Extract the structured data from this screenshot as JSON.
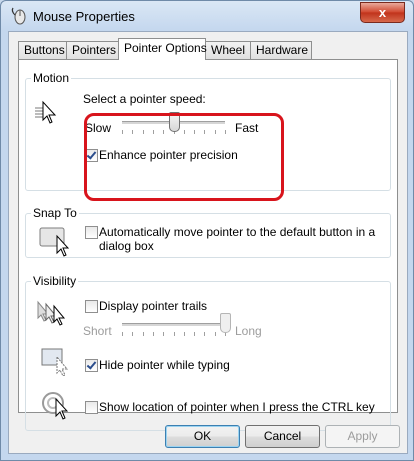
{
  "window": {
    "title": "Mouse Properties",
    "close_glyph": "x"
  },
  "tabs": [
    {
      "label": "Buttons",
      "active": false
    },
    {
      "label": "Pointers",
      "active": false
    },
    {
      "label": "Pointer Options",
      "active": true
    },
    {
      "label": "Wheel",
      "active": false
    },
    {
      "label": "Hardware",
      "active": false
    }
  ],
  "motion": {
    "group_label": "Motion",
    "speed_label": "Select a pointer speed:",
    "slow_label": "Slow",
    "fast_label": "Fast",
    "speed_value": 0.5,
    "enhance_label": "Enhance pointer precision",
    "enhance_checked": true,
    "highlight_color": "#d8141c"
  },
  "snap_to": {
    "group_label": "Snap To",
    "auto_label_line1": "Automatically move pointer to the default button in a",
    "auto_label_line2": "dialog box",
    "auto_checked": false
  },
  "visibility": {
    "group_label": "Visibility",
    "trails_label": "Display pointer trails",
    "trails_checked": false,
    "short_label": "Short",
    "long_label": "Long",
    "trails_value": 1.0,
    "hide_label": "Hide pointer while typing",
    "hide_checked": true,
    "show_location_label": "Show location of pointer when I press the CTRL key",
    "show_location_checked": false
  },
  "buttons": {
    "ok": "OK",
    "cancel": "Cancel",
    "apply": "Apply"
  }
}
